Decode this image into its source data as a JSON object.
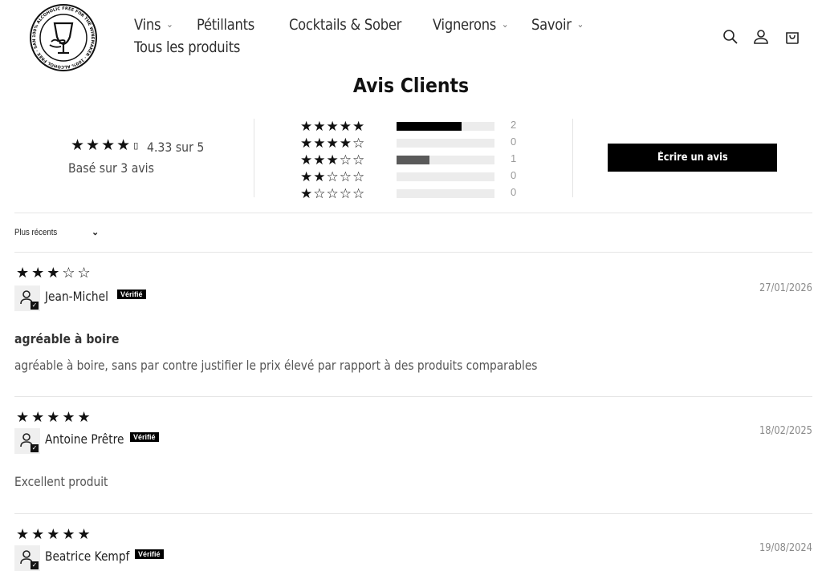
{
  "header": {
    "logo_ring_text": "100% ALCOHOLIC FREE FOR THE WINEMAKER · 100% ALCOHOL FREE · SANS ALCOOL DU VIGNERON",
    "nav": [
      {
        "label": "Vins",
        "has_dropdown": true
      },
      {
        "label": "Pétillants",
        "has_dropdown": false
      },
      {
        "label": "Cocktails & Sober",
        "has_dropdown": false
      },
      {
        "label": "Vignerons",
        "has_dropdown": true
      },
      {
        "label": "Savoir",
        "has_dropdown": true
      },
      {
        "label": "Tous les produits",
        "has_dropdown": false
      }
    ],
    "icons": [
      "search-icon",
      "account-icon",
      "cart-icon"
    ]
  },
  "summary": {
    "title": "Avis Clients",
    "average_rating": 4.33,
    "average_text": "4.33 sur 5",
    "based_on": "Basé sur 3 avis",
    "histogram": [
      {
        "stars": 5,
        "count": "2",
        "fraction": 0.667,
        "color": "#000000"
      },
      {
        "stars": 4,
        "count": "0",
        "fraction": 0,
        "color": "#000000"
      },
      {
        "stars": 3,
        "count": "1",
        "fraction": 0.333,
        "color": "#5a5a5a"
      },
      {
        "stars": 2,
        "count": "0",
        "fraction": 0,
        "color": "#000000"
      },
      {
        "stars": 1,
        "count": "0",
        "fraction": 0,
        "color": "#000000"
      }
    ],
    "write_review_label": "Écrire un avis"
  },
  "sort": {
    "selected": "Plus récents"
  },
  "reviews": [
    {
      "rating": 3,
      "author": "Jean-Michel",
      "verified_label": "Vérifié",
      "date": "27/01/2026",
      "title": "agréable à boire",
      "body": "agréable à boire, sans par contre justifier le prix élevé par rapport à des produits comparables"
    },
    {
      "rating": 5,
      "author": "Antoine Prêtre",
      "verified_label": "Vérifié",
      "date": "18/02/2025",
      "title": "",
      "body": "Excellent produit"
    },
    {
      "rating": 5,
      "author": "Beatrice Kempf",
      "verified_label": "Vérifié",
      "date": "19/08/2024",
      "title": "",
      "body": ""
    }
  ]
}
